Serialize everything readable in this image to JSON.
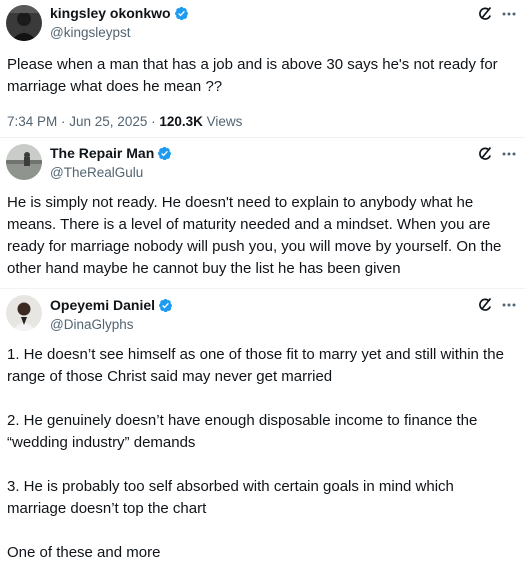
{
  "tweets": [
    {
      "name": "kingsley okonkwo",
      "handle": "@kingsleypst",
      "text": "Please when a man that has a job and  is above 30 says he's not ready for marriage what does he mean ??",
      "time": "7:34 PM · Jun 25, 2025 · ",
      "views_count": "120.3K",
      "views_label": " Views"
    },
    {
      "name": "The Repair Man",
      "handle": "@TheRealGulu",
      "text": "He is simply not ready. He doesn't need to explain to anybody what he means. There is a level of maturity needed and a mindset. When you are ready for marriage nobody will push you, you will move by yourself. On the other hand maybe he cannot buy the list he has been given"
    },
    {
      "name": "Opeyemi Daniel",
      "handle": "@DinaGlyphs",
      "paragraphs": [
        "1. He doesn’t see himself as one of those fit to marry yet and still within the range of those Christ said may never get married",
        "2. He genuinely doesn’t have enough disposable income to finance the “wedding industry” demands",
        "3. He is probably too self absorbed with certain goals in mind which marriage doesn’t top the chart",
        "One of these and more"
      ]
    }
  ],
  "colors": {
    "verified": "#1d9bf0",
    "secondary_text": "#536471",
    "primary_text": "#0f1419"
  },
  "icons": {
    "verified": "verified-badge-icon",
    "grok": "grok-icon",
    "more": "more-icon"
  }
}
